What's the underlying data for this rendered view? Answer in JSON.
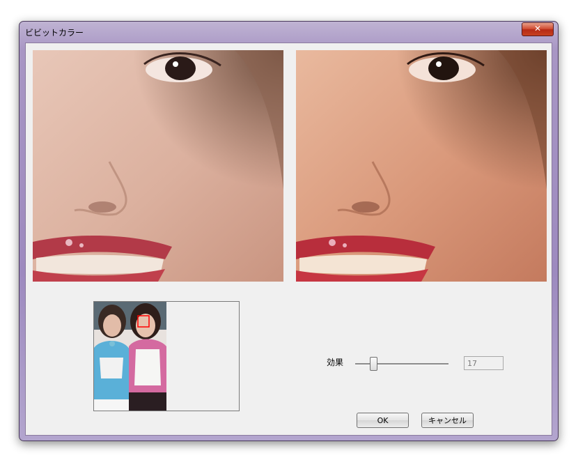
{
  "window": {
    "title": "ビビットカラー",
    "close_symbol": "✕"
  },
  "controls": {
    "effect_label": "効果",
    "effect_value": "17",
    "ok_label": "OK",
    "cancel_label": "キャンセル"
  },
  "icons": {
    "close": "close-icon"
  }
}
